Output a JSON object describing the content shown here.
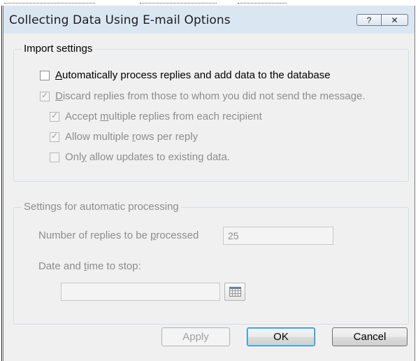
{
  "dialog": {
    "title": "Collecting Data Using E-mail Options",
    "help_glyph": "?",
    "close_glyph": "✕"
  },
  "import_settings": {
    "group_label": "Import settings",
    "options": [
      {
        "pre": "",
        "accel": "A",
        "post": "utomatically process replies and add data to the database",
        "checked": false,
        "enabled": true
      },
      {
        "pre": "",
        "accel": "D",
        "post": "iscard replies from those to whom you did not send the message.",
        "checked": true,
        "enabled": false
      },
      {
        "pre": "Accept ",
        "accel": "m",
        "post": "ultiple replies from each recipient",
        "checked": true,
        "enabled": false
      },
      {
        "pre": "Allow multiple ",
        "accel": "r",
        "post": "ows per reply",
        "checked": true,
        "enabled": false
      },
      {
        "pre": "Onl",
        "accel": "y",
        "post": " allow updates to existing data.",
        "checked": false,
        "enabled": false
      }
    ]
  },
  "automatic_processing": {
    "group_label": "Settings for automatic processing",
    "replies_label_pre": "Number of replies to be ",
    "replies_label_accel": "p",
    "replies_label_post": "rocessed",
    "replies_value": "25",
    "stop_label_pre": "Date and ",
    "stop_label_accel": "t",
    "stop_label_post": "ime to stop:",
    "stop_value": ""
  },
  "buttons": {
    "apply": "Apply",
    "ok": "OK",
    "cancel": "Cancel"
  },
  "icons": {
    "checkmark": "✓",
    "calendar": "calendar-icon"
  }
}
